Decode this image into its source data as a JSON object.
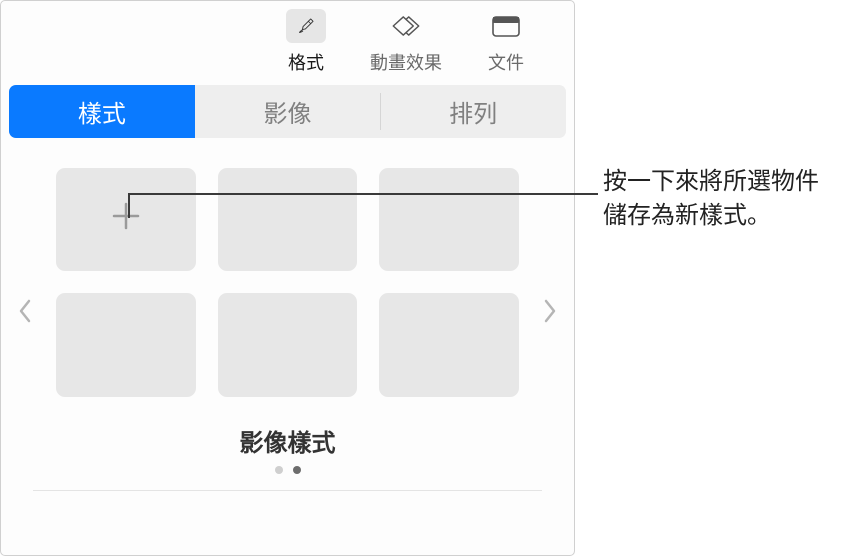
{
  "toolbar": {
    "format": "格式",
    "animate": "動畫效果",
    "document": "文件"
  },
  "tabs": {
    "style": "樣式",
    "image": "影像",
    "arrange": "排列"
  },
  "styles_section": {
    "title": "影像樣式",
    "page_count": 2,
    "active_page": 1
  },
  "annotation": {
    "text": "按一下來將所選物件\n儲存為新樣式。"
  }
}
